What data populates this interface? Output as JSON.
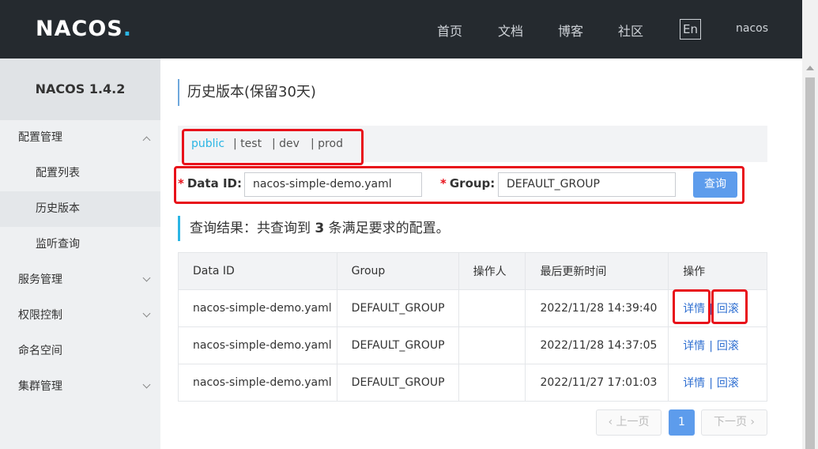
{
  "header": {
    "logo": "NACOS.",
    "nav": [
      "首页",
      "文档",
      "博客",
      "社区"
    ],
    "lang_button": "En",
    "user": "nacos"
  },
  "sidebar": {
    "version": "NACOS 1.4.2",
    "items": [
      {
        "label": "配置管理",
        "expanded": true
      },
      {
        "label": "配置列表"
      },
      {
        "label": "历史版本",
        "active": true
      },
      {
        "label": "监听查询"
      },
      {
        "label": "服务管理",
        "expanded": false
      },
      {
        "label": "权限控制",
        "expanded": false
      },
      {
        "label": "命名空间"
      },
      {
        "label": "集群管理",
        "expanded": false
      }
    ]
  },
  "main": {
    "title": "历史版本(保留30天)",
    "namespaces": [
      "public",
      "| test",
      "| dev",
      "| prod"
    ],
    "active_namespace": "public",
    "form": {
      "required_mark": "*",
      "data_id_label": "Data ID:",
      "data_id_value": "nacos-simple-demo.yaml",
      "group_label": "Group:",
      "group_value": "DEFAULT_GROUP",
      "query_button": "查询"
    },
    "result": {
      "prefix": "查询结果：共查询到",
      "count": "3",
      "suffix": "条满足要求的配置。"
    },
    "table": {
      "columns": [
        "Data ID",
        "Group",
        "操作人",
        "最后更新时间",
        "操作"
      ],
      "rows": [
        {
          "data_id": "nacos-simple-demo.yaml",
          "group": "DEFAULT_GROUP",
          "operator": "",
          "time": "2022/11/28 14:39:40"
        },
        {
          "data_id": "nacos-simple-demo.yaml",
          "group": "DEFAULT_GROUP",
          "operator": "",
          "time": "2022/11/28 14:37:05"
        },
        {
          "data_id": "nacos-simple-demo.yaml",
          "group": "DEFAULT_GROUP",
          "operator": "",
          "time": "2022/11/27 17:01:03"
        }
      ],
      "action_detail": "详情",
      "action_separator": "|",
      "action_rollback": "回滚"
    },
    "pagination": {
      "prev": "上一页",
      "current": "1",
      "next": "下一页"
    }
  },
  "colors": {
    "header_bg": "#252a2f",
    "accent": "#2bb5e4",
    "primary_button": "#5d9cec",
    "highlight_box": "#e8111a",
    "link": "#2f6fd1"
  }
}
